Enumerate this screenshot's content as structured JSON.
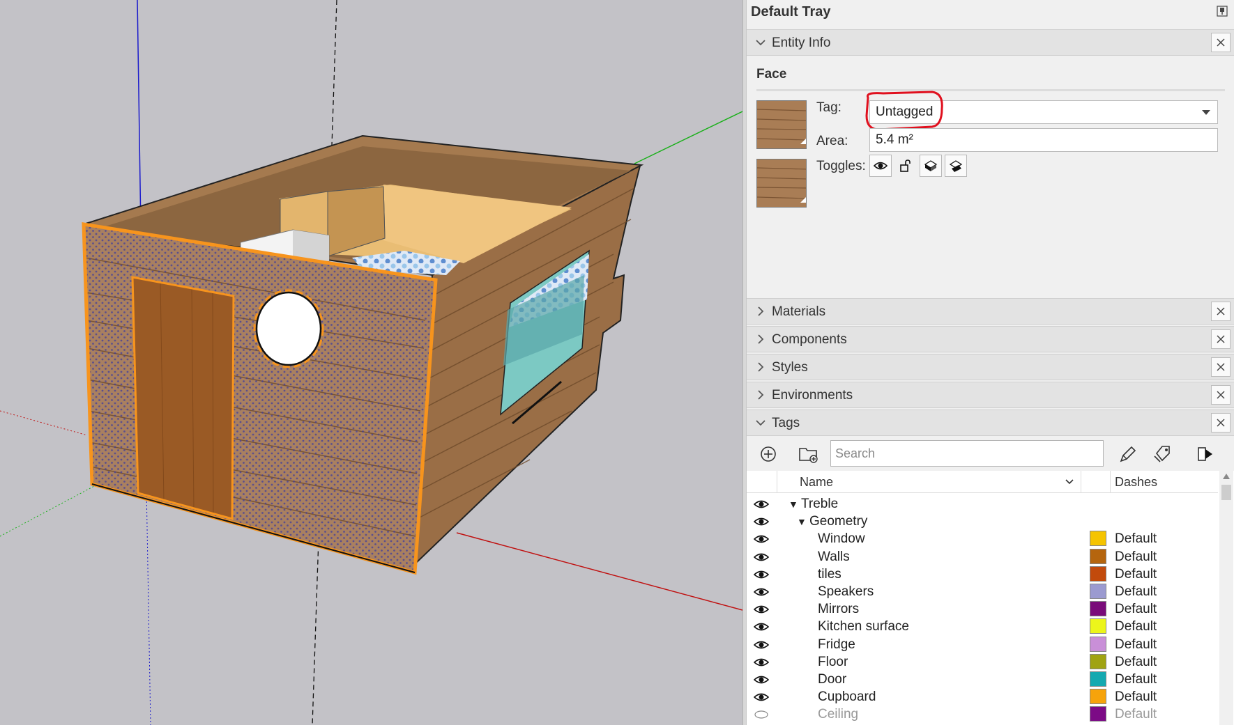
{
  "tray": {
    "title": "Default Tray"
  },
  "panels": {
    "entity_info": "Entity Info",
    "materials": "Materials",
    "components": "Components",
    "styles": "Styles",
    "environments": "Environments",
    "tags": "Tags"
  },
  "entity": {
    "type": "Face",
    "tag_label": "Tag:",
    "tag_value": "Untagged",
    "area_label": "Area:",
    "area_value": "5.4 m²",
    "toggles_label": "Toggles:"
  },
  "tags_panel": {
    "search_placeholder": "Search",
    "col_name": "Name",
    "col_dashes": "Dashes",
    "rows": [
      {
        "name": "Treble",
        "level": 0,
        "folder": true,
        "visible": true
      },
      {
        "name": "Geometry",
        "level": 1,
        "folder": true,
        "visible": true
      },
      {
        "name": "Window",
        "level": 2,
        "color": "#f5c400",
        "dashes": "Default",
        "visible": true
      },
      {
        "name": "Walls",
        "level": 2,
        "color": "#b5650e",
        "dashes": "Default",
        "visible": true
      },
      {
        "name": "tiles",
        "level": 2,
        "color": "#c24a0c",
        "dashes": "Default",
        "visible": true
      },
      {
        "name": "Speakers",
        "level": 2,
        "color": "#9b9ad0",
        "dashes": "Default",
        "visible": true
      },
      {
        "name": "Mirrors",
        "level": 2,
        "color": "#7a0c7a",
        "dashes": "Default",
        "visible": true
      },
      {
        "name": "Kitchen surface",
        "level": 2,
        "color": "#ecf51b",
        "dashes": "Default",
        "visible": true
      },
      {
        "name": "Fridge",
        "level": 2,
        "color": "#c98fd8",
        "dashes": "Default",
        "visible": true
      },
      {
        "name": "Floor",
        "level": 2,
        "color": "#a0a312",
        "dashes": "Default",
        "visible": true
      },
      {
        "name": "Door",
        "level": 2,
        "color": "#14a9b0",
        "dashes": "Default",
        "visible": true
      },
      {
        "name": "Cupboard",
        "level": 2,
        "color": "#f6a30b",
        "dashes": "Default",
        "visible": true
      },
      {
        "name": "Ceiling",
        "level": 2,
        "color": "#7c0a86",
        "dashes": "Default",
        "visible": false
      }
    ]
  }
}
